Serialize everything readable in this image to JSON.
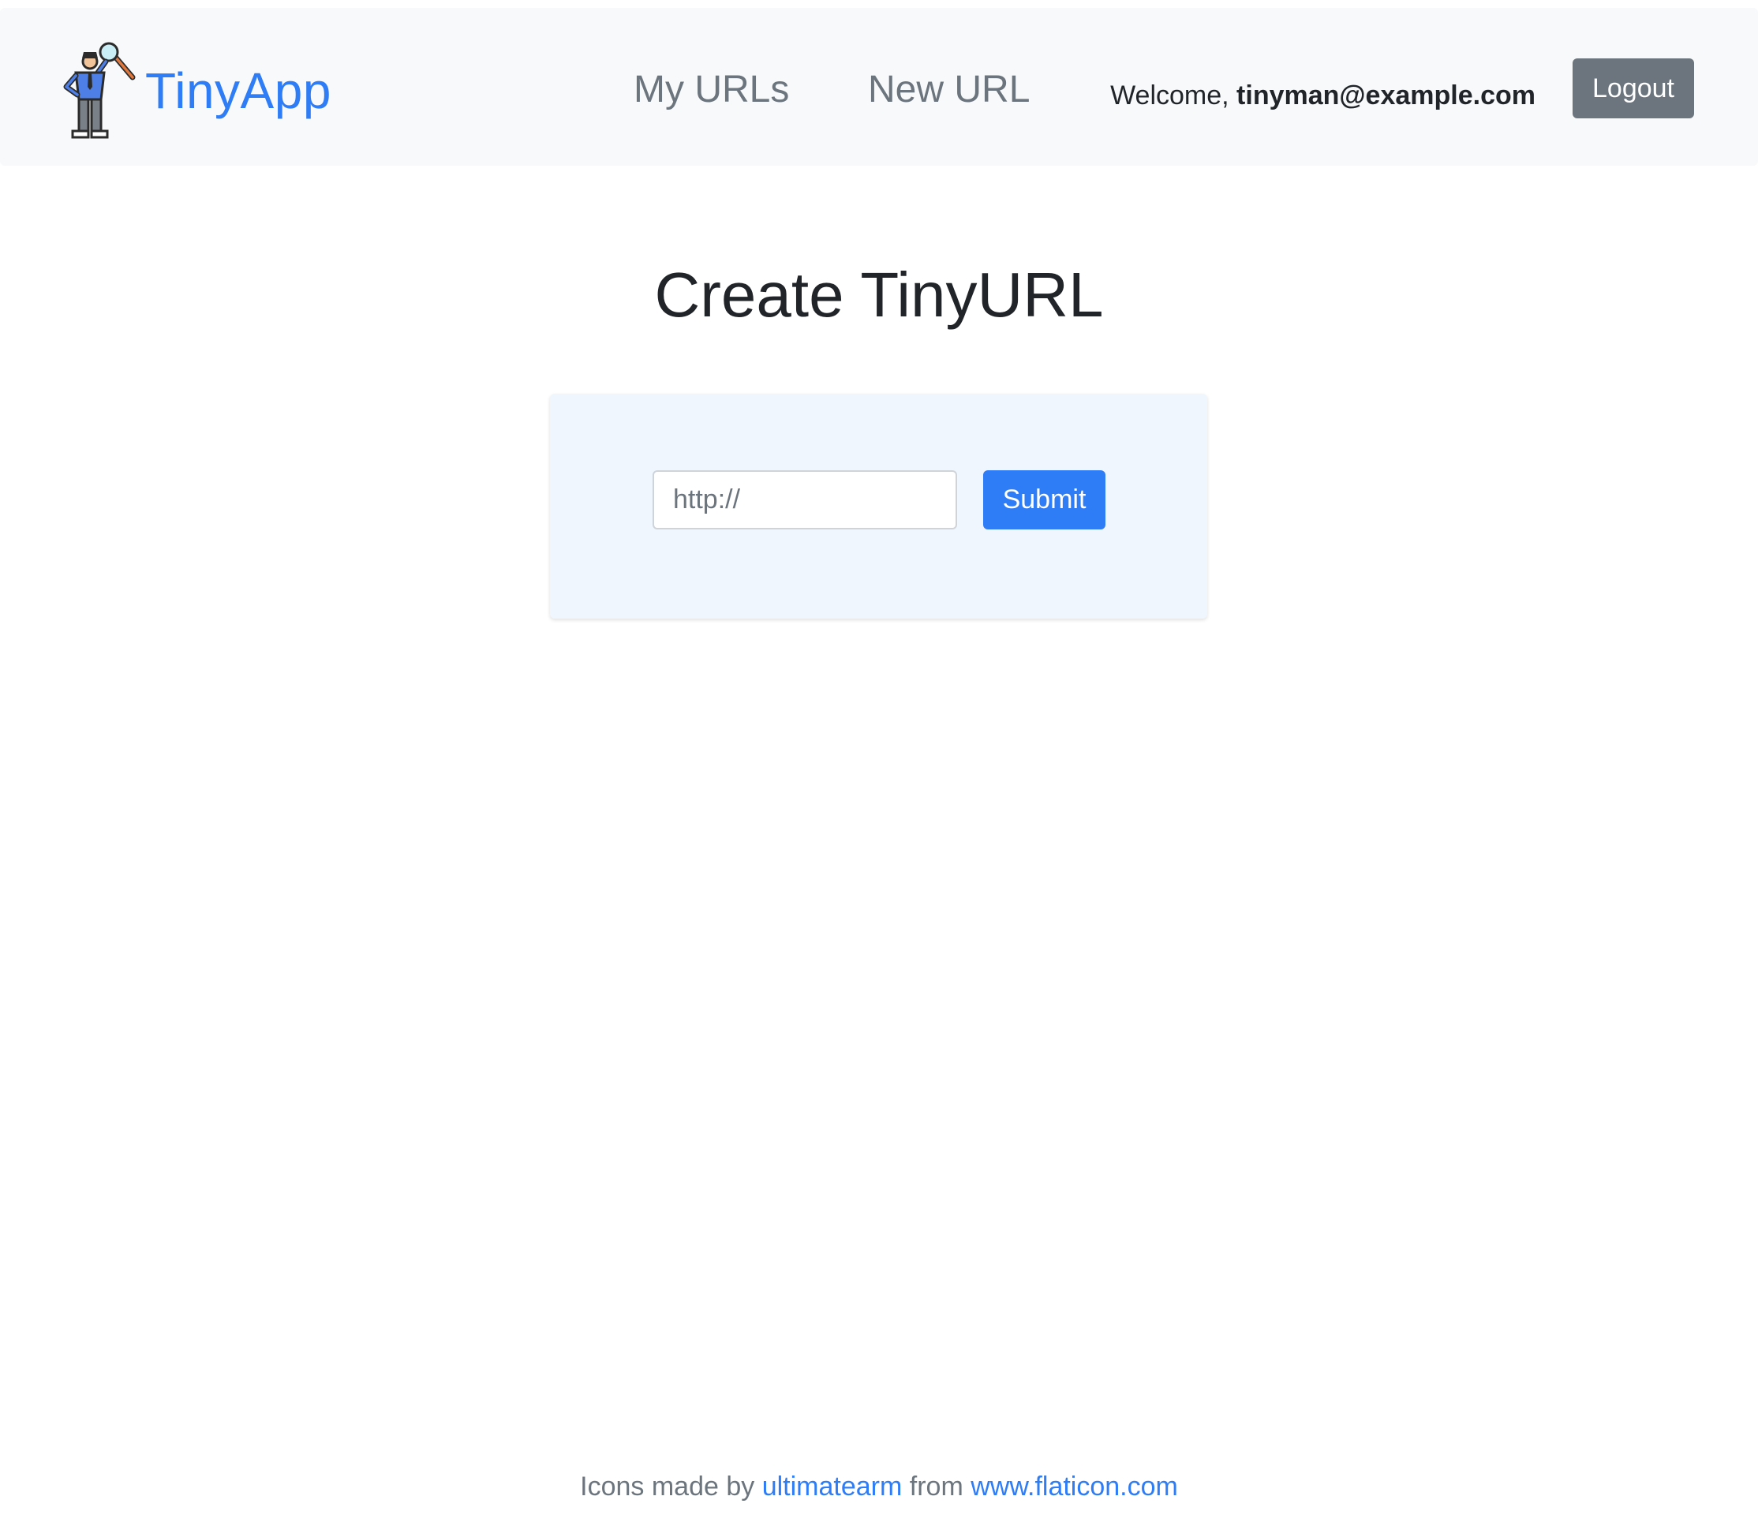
{
  "app": {
    "brand_name": "TinyApp",
    "brand_icon": "detective-with-magnifier-icon",
    "accent_color": "#2f7df6"
  },
  "nav": {
    "items": [
      {
        "label": "My URLs"
      },
      {
        "label": "New URL"
      }
    ],
    "welcome_prefix": "Welcome,",
    "user_email": "tinyman@example.com",
    "logout_label": "Logout"
  },
  "main": {
    "title": "Create TinyURL",
    "form": {
      "url_placeholder": "http://",
      "url_value": "",
      "submit_label": "Submit"
    }
  },
  "footer": {
    "prefix": "Icons made by",
    "author": "ultimatearm",
    "middle": "from",
    "site": "www.flaticon.com"
  }
}
